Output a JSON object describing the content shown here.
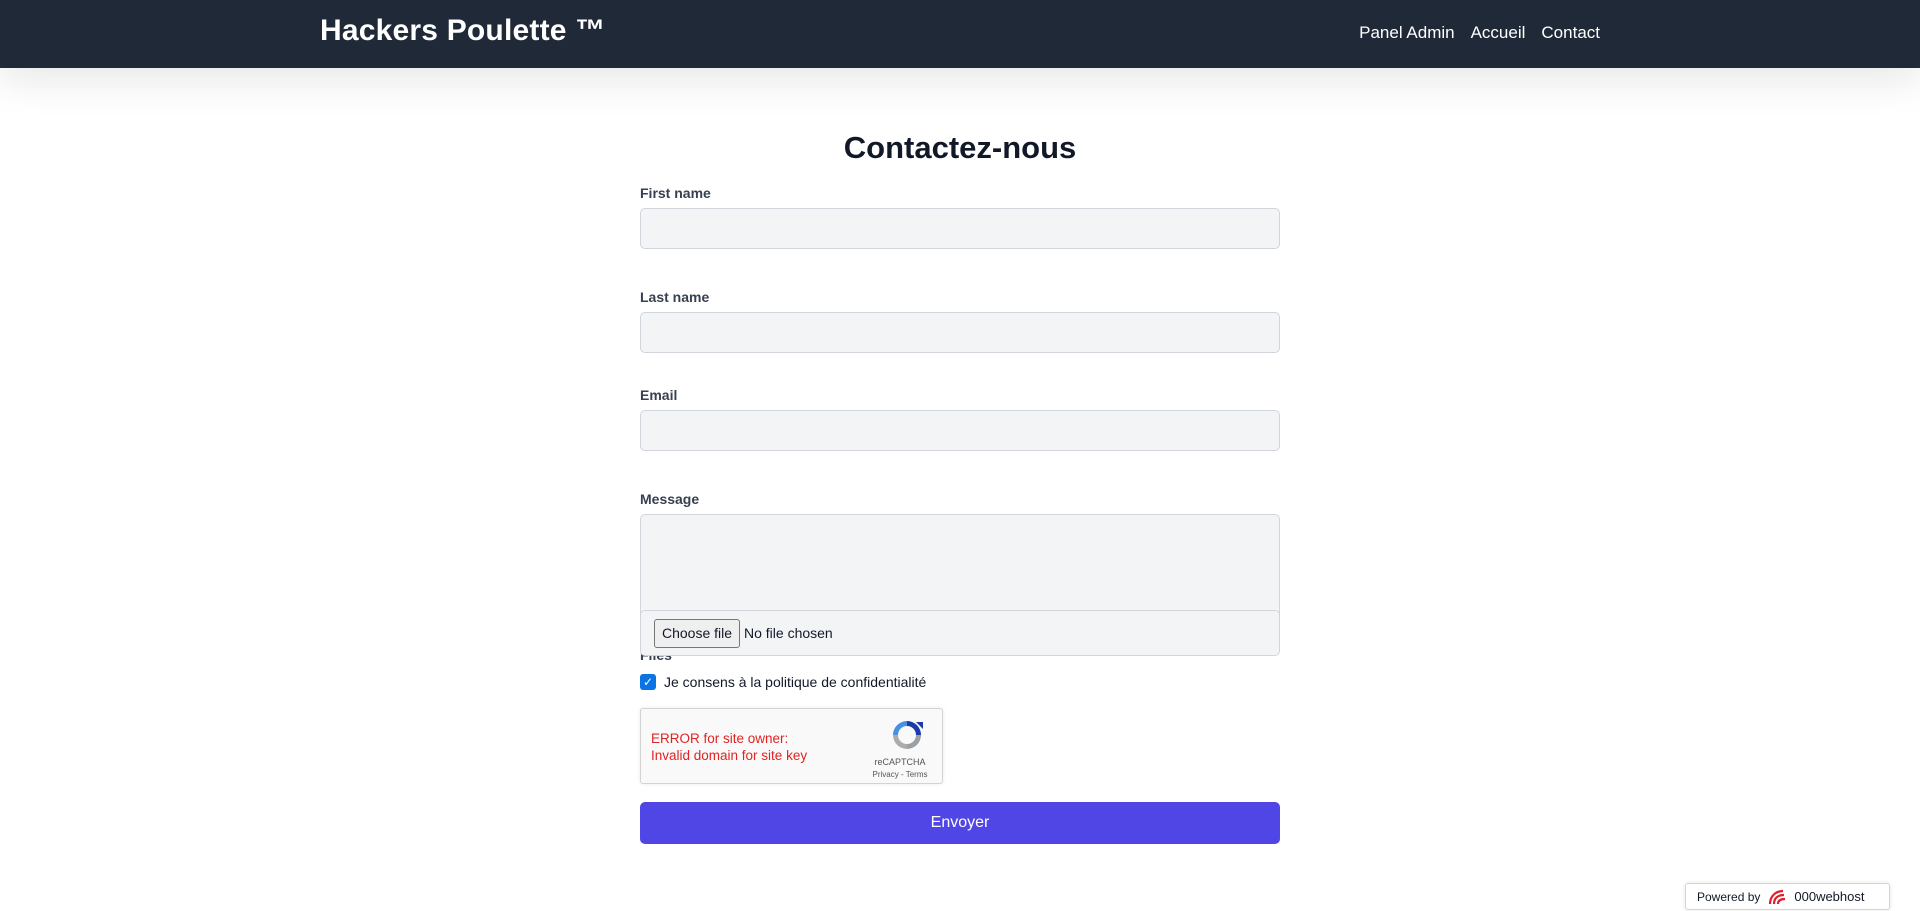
{
  "navbar": {
    "brand": "Hackers Poulette ™",
    "links": [
      "Panel Admin",
      "Accueil",
      "Contact"
    ]
  },
  "page": {
    "title": "Contactez-nous"
  },
  "form": {
    "first_name_label": "First name",
    "first_name_value": "",
    "last_name_label": "Last name",
    "last_name_value": "",
    "email_label": "Email",
    "email_value": "",
    "message_label": "Message",
    "message_value": "",
    "files_label": "Files",
    "file_button": "Choose file",
    "file_status": "No file chosen",
    "consent_label": "Je consens à la politique de confidentialité",
    "consent_checked": true,
    "submit_label": "Envoyer"
  },
  "recaptcha": {
    "error_line1": "ERROR for site owner:",
    "error_line2": "Invalid domain for site key",
    "brand": "reCAPTCHA",
    "links": "Privacy - Terms",
    "error_color": "#e02424"
  },
  "footer_badge": {
    "powered_by": "Powered by",
    "host": "000webhost"
  },
  "colors": {
    "navbar_bg": "#1f2937",
    "primary_button": "#4f46e5",
    "checkbox": "#0b74e5",
    "input_bg": "#f3f4f6"
  }
}
